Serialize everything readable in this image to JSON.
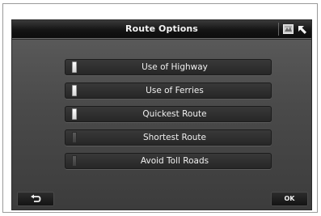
{
  "titlebar": {
    "title": "Route Options",
    "icons": [
      "map-icon",
      "arrow-cursor-icon"
    ]
  },
  "options": [
    {
      "label": "Use of Highway",
      "enabled": true
    },
    {
      "label": "Use of Ferries",
      "enabled": true
    },
    {
      "label": "Quickest Route",
      "enabled": true
    },
    {
      "label": "Shortest Route",
      "enabled": false
    },
    {
      "label": "Avoid Toll Roads",
      "enabled": false
    }
  ],
  "footer": {
    "back_icon": "back-arrow-icon",
    "ok_label": "OK"
  },
  "colors": {
    "indicator_on": "#ffffff",
    "indicator_off": "#4a4a4a",
    "panel": "#4a4a4a",
    "titlebar": "#141414"
  }
}
